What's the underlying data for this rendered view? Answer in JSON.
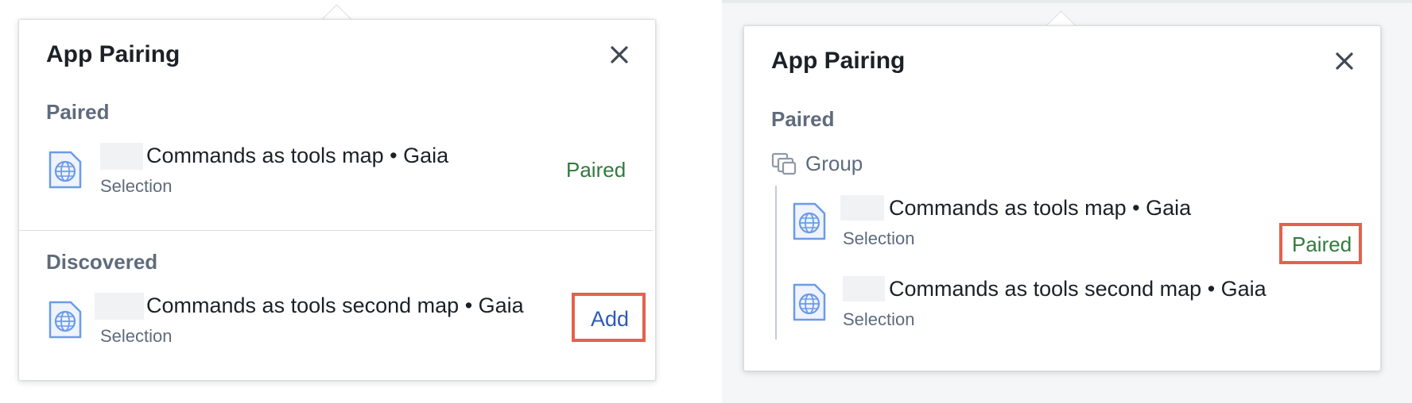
{
  "left_panel": {
    "title": "App Pairing",
    "sections": {
      "paired": {
        "label": "Paired",
        "item": {
          "title": "Commands as tools map • Gaia",
          "subtitle": "Selection",
          "status": "Paired"
        }
      },
      "discovered": {
        "label": "Discovered",
        "item": {
          "title": "Commands as tools second map • Gaia",
          "subtitle": "Selection",
          "action": "Add"
        }
      }
    }
  },
  "right_panel": {
    "title": "App Pairing",
    "section_label": "Paired",
    "group_label": "Group",
    "items": [
      {
        "title": "Commands as tools map • Gaia",
        "subtitle": "Selection"
      },
      {
        "title": "Commands as tools second map • Gaia",
        "subtitle": "Selection"
      }
    ],
    "group_status": "Paired"
  },
  "colors": {
    "paired_green": "#317a3d",
    "add_blue": "#2d5ab8",
    "highlight_red": "#e4614e",
    "icon_blue": "#6c9be8"
  },
  "icons": {
    "close": "close-icon",
    "app": "globe-app-icon",
    "group": "group-icon"
  }
}
